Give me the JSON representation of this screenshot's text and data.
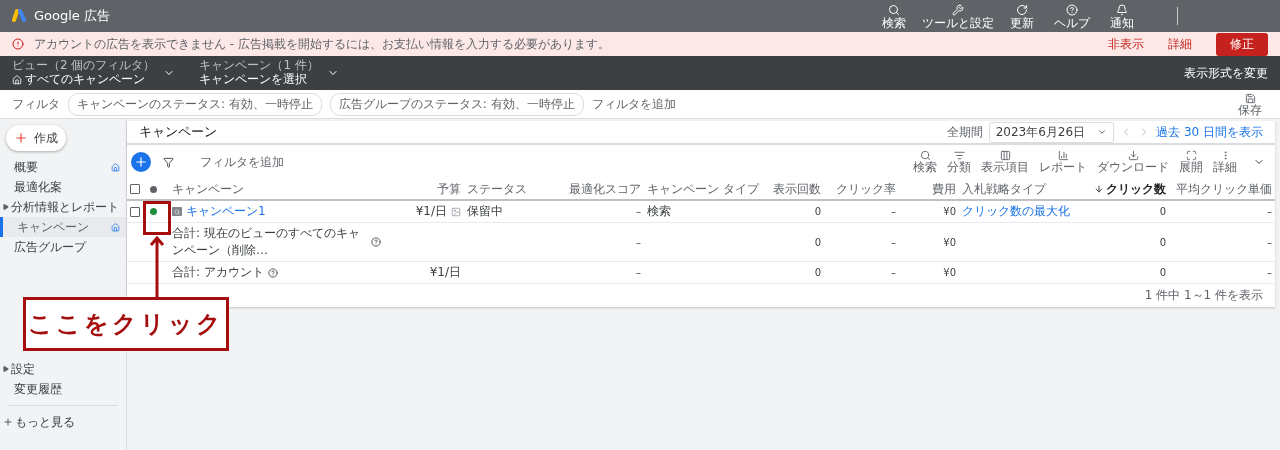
{
  "app_bar": {
    "title": "Google 広告",
    "actions": [
      "検索",
      "ツールと設定",
      "更新",
      "ヘルプ",
      "通知"
    ]
  },
  "alert": {
    "message": "アカウントの広告を表示できません - 広告掲載を開始するには、お支払い情報を入力する必要があります。",
    "links": [
      "非表示",
      "詳細"
    ],
    "button": "修正"
  },
  "scope_bar": {
    "selectors": [
      {
        "caption": "ビュー（2 個のフィルタ）",
        "value": "すべてのキャンペーン",
        "home": true
      },
      {
        "caption": "キャンペーン（1 件）",
        "value": "キャンペーンを選択",
        "home": false
      }
    ],
    "view_link": "表示形式を変更"
  },
  "filter_bar": {
    "label": "フィルタ",
    "chips": [
      "キャンペーンのステータス: 有効、一時停止",
      "広告グループのステータス: 有効、一時停止"
    ],
    "add": "フィルタを追加",
    "save": "保存"
  },
  "sidebar": {
    "create": "作成",
    "items": [
      {
        "label": "概要",
        "expandable": false,
        "home": true,
        "selected": false
      },
      {
        "label": "最適化案",
        "expandable": false,
        "home": false,
        "selected": false
      },
      {
        "label": "分析情報とレポート",
        "expandable": true,
        "home": false,
        "selected": false
      },
      {
        "label": "キャンペーン",
        "expandable": false,
        "home": true,
        "selected": true
      },
      {
        "label": "広告グループ",
        "expandable": false,
        "home": false,
        "selected": false
      },
      {
        "label": "設定",
        "expandable": true,
        "home": false,
        "selected": false
      },
      {
        "label": "変更履歴",
        "expandable": false,
        "home": false,
        "selected": false
      }
    ],
    "more": "もっと見る"
  },
  "page": {
    "title": "キャンペーン",
    "date_label": "全期間",
    "date": "2023年6月26日",
    "range_link": "過去 30 日間を表示"
  },
  "toolbar": {
    "filter_placeholder": "フィルタを追加",
    "tools": [
      "検索",
      "分類",
      "表示項目",
      "レポート",
      "ダウンロード",
      "展開",
      "詳細"
    ]
  },
  "table": {
    "header_checked": false,
    "columns": [
      {
        "label": "キャンペーン",
        "sorted": false
      },
      {
        "label": "予算",
        "sorted": false
      },
      {
        "label": "ステータス",
        "sorted": false
      },
      {
        "label": "最適化スコア",
        "sorted": false
      },
      {
        "label": "キャンペーン タイプ",
        "sorted": false
      },
      {
        "label": "表示回数",
        "sorted": false
      },
      {
        "label": "クリック率",
        "sorted": false
      },
      {
        "label": "費用",
        "sorted": false
      },
      {
        "label": "入札戦略タイプ",
        "sorted": false
      },
      {
        "label": "クリック数",
        "sorted": true
      },
      {
        "label": "平均クリック単価",
        "sorted": false
      }
    ],
    "rows": [
      {
        "kind": "campaign",
        "checked": false,
        "color": "#1e8e3e",
        "cells": [
          "キャンペーン1",
          "¥1/日",
          "保留中",
          "–",
          "検索",
          "0",
          "–",
          "¥0",
          "クリック数の最大化",
          "0",
          "–"
        ]
      },
      {
        "kind": "total",
        "cells": [
          "合計: 現在のビューのすべてのキャンペーン（削除…",
          null,
          null,
          "–",
          null,
          "0",
          "–",
          "¥0",
          null,
          "0",
          "–"
        ]
      },
      {
        "kind": "total",
        "cells": [
          "合計: アカウント",
          "¥1/日",
          null,
          "–",
          null,
          "0",
          "–",
          "¥0",
          null,
          "0",
          "–"
        ]
      }
    ],
    "footer": "1 件中 1～1 件を表示"
  },
  "callout": {
    "text": "ここをクリック"
  }
}
